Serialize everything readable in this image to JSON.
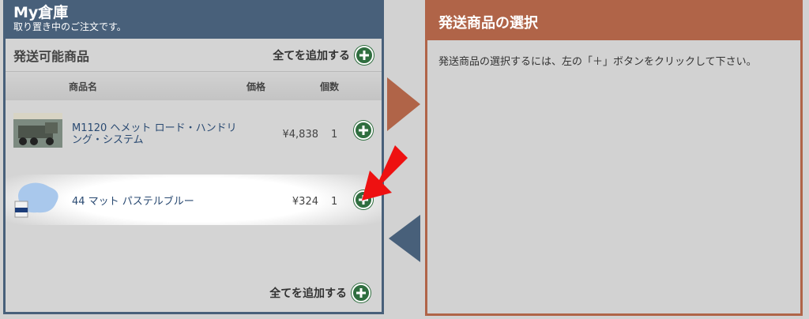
{
  "left": {
    "title": "My倉庫",
    "subtitle": "取り置き中のご注文です。",
    "section_title": "発送可能商品",
    "add_all_label": "全てを追加する",
    "columns": {
      "name": "商品名",
      "price": "価格",
      "qty": "個数"
    },
    "items": [
      {
        "name": "M1120 ヘメット ロード・ハンドリング・システム",
        "price": "¥4,838",
        "qty": "1"
      },
      {
        "name": "44 マット パステルブルー",
        "price": "¥324",
        "qty": "1"
      }
    ],
    "add_all_bottom_label": "全てを追加する"
  },
  "right": {
    "title": "発送商品の選択",
    "instruction": "発送商品の選択するには、左の「＋」ボタンをクリックして下さい。"
  },
  "colors": {
    "blue": "#48607a",
    "brown": "#b06448",
    "green": "#2f6e3f",
    "red": "#ee1111"
  },
  "icons": [
    "plus-circle-icon",
    "right-arrow-icon",
    "left-arrow-icon",
    "red-pointer-arrow-icon"
  ]
}
